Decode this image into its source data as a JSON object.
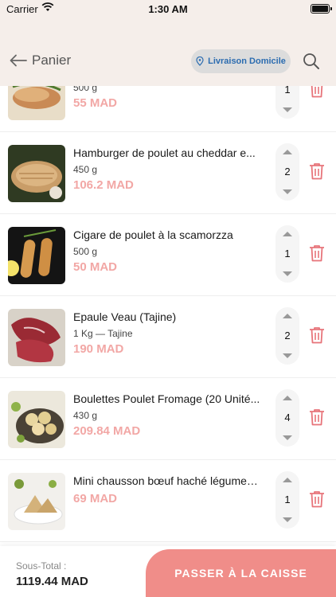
{
  "status_bar": {
    "carrier": "Carrier",
    "time": "1:30 AM"
  },
  "header": {
    "back_label": "Panier",
    "delivery_label": "Livraison Domicile"
  },
  "colors": {
    "accent": "#f08d89",
    "price": "#f2a7a5",
    "header_bg": "#f5eeea",
    "delivery_text": "#2b6cb0"
  },
  "items": [
    {
      "name": "",
      "weight": "500 g",
      "price": "55 MAD",
      "qty": "1"
    },
    {
      "name": "Hamburger de poulet au cheddar e...",
      "weight": "450 g",
      "price": "106.2 MAD",
      "qty": "2"
    },
    {
      "name": "Cigare de poulet à la scamorzza",
      "weight": "500 g",
      "price": "50 MAD",
      "qty": "1"
    },
    {
      "name": "Epaule Veau (Tajine)",
      "weight": "1 Kg — Tajine",
      "price": "190 MAD",
      "qty": "2"
    },
    {
      "name": "Boulettes Poulet Fromage (20 Unité...",
      "weight": "430 g",
      "price": "209.84 MAD",
      "qty": "4"
    },
    {
      "name": "Mini chausson bœuf haché légumes...",
      "weight": "",
      "price": "69 MAD",
      "qty": "1"
    }
  ],
  "footer": {
    "subtotal_label": "Sous-Total :",
    "subtotal_value": "1119.44 MAD",
    "checkout_label": "PASSER À LA CAISSE"
  }
}
